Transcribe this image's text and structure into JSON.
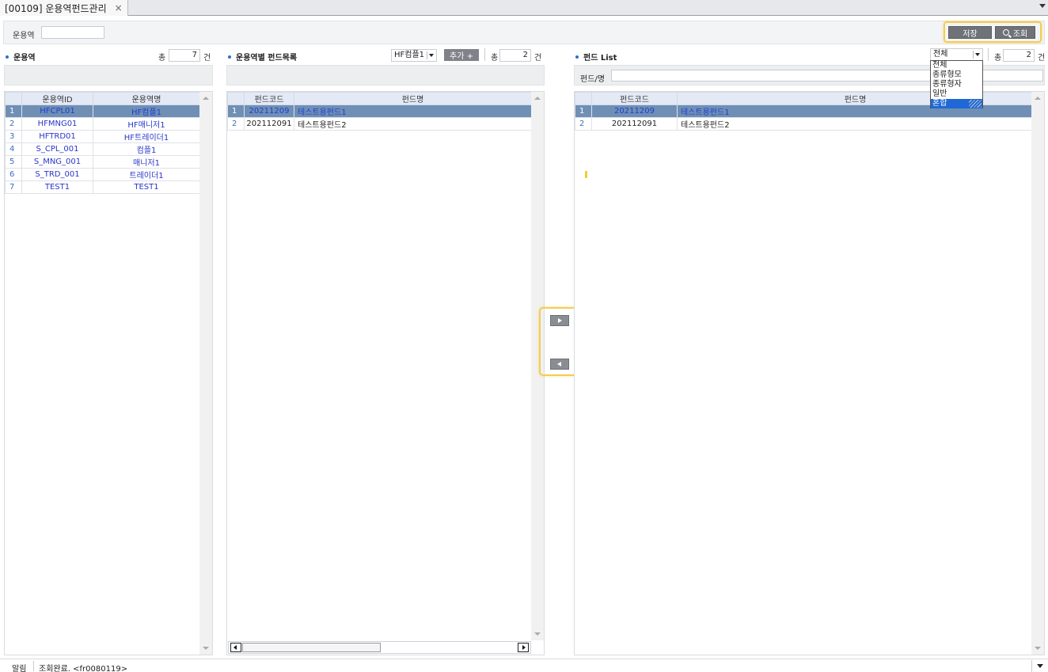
{
  "tab": {
    "title": "[00109] 운용역펀드관리",
    "close": "×"
  },
  "search": {
    "label": "운용역",
    "value": ""
  },
  "toolbar": {
    "save_label": "저장",
    "query_label": "조회"
  },
  "left_panel": {
    "title": "운용역",
    "count_label": "총",
    "count": "7",
    "count_unit": "건",
    "columns": [
      "운용역ID",
      "운용역명"
    ],
    "rows": [
      {
        "no": "1",
        "id": "HFCPL01",
        "name": "HF컴플1"
      },
      {
        "no": "2",
        "id": "HFMNG01",
        "name": "HF매니저1"
      },
      {
        "no": "3",
        "id": "HFTRD01",
        "name": "HF트레이더1"
      },
      {
        "no": "4",
        "id": "S_CPL_001",
        "name": "컴플1"
      },
      {
        "no": "5",
        "id": "S_MNG_001",
        "name": "매니저1"
      },
      {
        "no": "6",
        "id": "S_TRD_001",
        "name": "트레이더1"
      },
      {
        "no": "7",
        "id": "TEST1",
        "name": "TEST1"
      }
    ]
  },
  "middle_panel": {
    "title": "운용역별 펀드목록",
    "combo_value": "HF컴플1",
    "add_label": "추가 +",
    "count_label": "총",
    "count": "2",
    "count_unit": "건",
    "columns": [
      "펀드코드",
      "펀드명"
    ],
    "rows": [
      {
        "no": "1",
        "code": "20211209",
        "name": "테스트용펀드1"
      },
      {
        "no": "2",
        "code": "202112091",
        "name": "테스트용펀드2"
      }
    ]
  },
  "right_panel": {
    "title": "펀드 List",
    "filter_value": "전체",
    "count_label": "총",
    "count": "2",
    "count_unit": "건",
    "fund_filter_label": "펀드/명",
    "fund_filter_value": "",
    "columns": [
      "펀드코드",
      "펀드명"
    ],
    "rows": [
      {
        "no": "1",
        "code": "20211209",
        "name": "테스트용펀드1"
      },
      {
        "no": "2",
        "code": "202112091",
        "name": "테스트용펀드2"
      }
    ],
    "dropdown_options": [
      "전체",
      "종류형모",
      "종류형자",
      "일반",
      "혼합"
    ]
  },
  "status": {
    "label": "알림",
    "message": "조회완료. <fr0080119>"
  },
  "colors": {
    "accent_highlight": "#f3cd4f",
    "selected_row": "#6f8fb5",
    "header_bg": "#e3eaf6",
    "link_blue": "#2a36c8"
  }
}
